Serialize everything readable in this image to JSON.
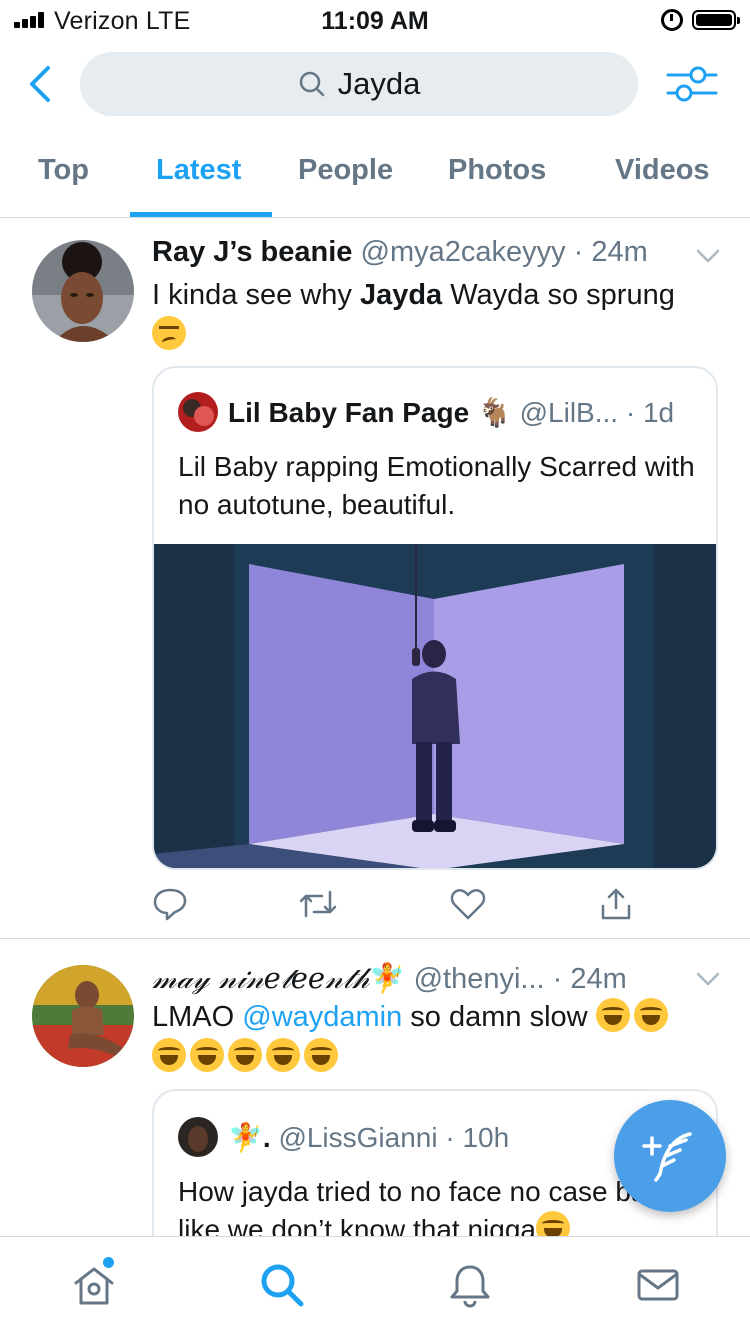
{
  "status_bar": {
    "carrier": "Verizon  LTE",
    "time": "11:09 AM"
  },
  "search": {
    "query": "Jayda"
  },
  "tabs": [
    {
      "label": "Top",
      "active": false
    },
    {
      "label": "Latest",
      "active": true
    },
    {
      "label": "People",
      "active": false
    },
    {
      "label": "Photos",
      "active": false
    },
    {
      "label": "Videos",
      "active": false
    }
  ],
  "tweets": [
    {
      "name": "Ray J’s beanie",
      "handle": "@mya2cakeyyy",
      "time": "24m",
      "text_pre": "I kinda see why ",
      "text_bold": "Jayda",
      "text_post": " Wayda so sprung",
      "emoji": "woozy-face",
      "quote": {
        "name": "Lil Baby Fan Page",
        "badge_emoji": "🐐",
        "handle": "@LilB...",
        "time": "1d",
        "text": "Lil Baby rapping Emotionally Scarred with no autotune, beautiful."
      }
    },
    {
      "name": "𝓂𝒶𝓎 𝓃𝒾𝓃𝑒𝓉𝑒𝑒𝓃𝓉𝒽",
      "name_emoji": "🧚",
      "handle": "@thenyi...",
      "time": "24m",
      "text_pre": "LMAO ",
      "mention": "@waydamin",
      "text_post": " so damn slow",
      "emoji": "face-with-tears-of-joy",
      "emoji_count": 7,
      "quote": {
        "name_emoji": "🧚",
        "name": ".",
        "handle": "@LissGianni",
        "time": "10h",
        "text": "How jayda tried to no face no case baby like we don’t know that nigga"
      }
    }
  ],
  "colors": {
    "accent": "#1da1f2",
    "fab": "#4a9fe8",
    "secondary_text": "#657786",
    "search_bg": "#e6ecf0"
  },
  "icons": {
    "back": "chevron-left-icon",
    "search": "search-icon",
    "filter": "filter-sliders-icon",
    "caret": "chevron-down-icon",
    "reply": "reply-icon",
    "retweet": "retweet-icon",
    "like": "heart-icon",
    "share": "share-icon",
    "compose": "compose-tweet-icon",
    "home": "home-icon",
    "explore": "search-icon",
    "notifications": "bell-icon",
    "messages": "envelope-icon"
  }
}
